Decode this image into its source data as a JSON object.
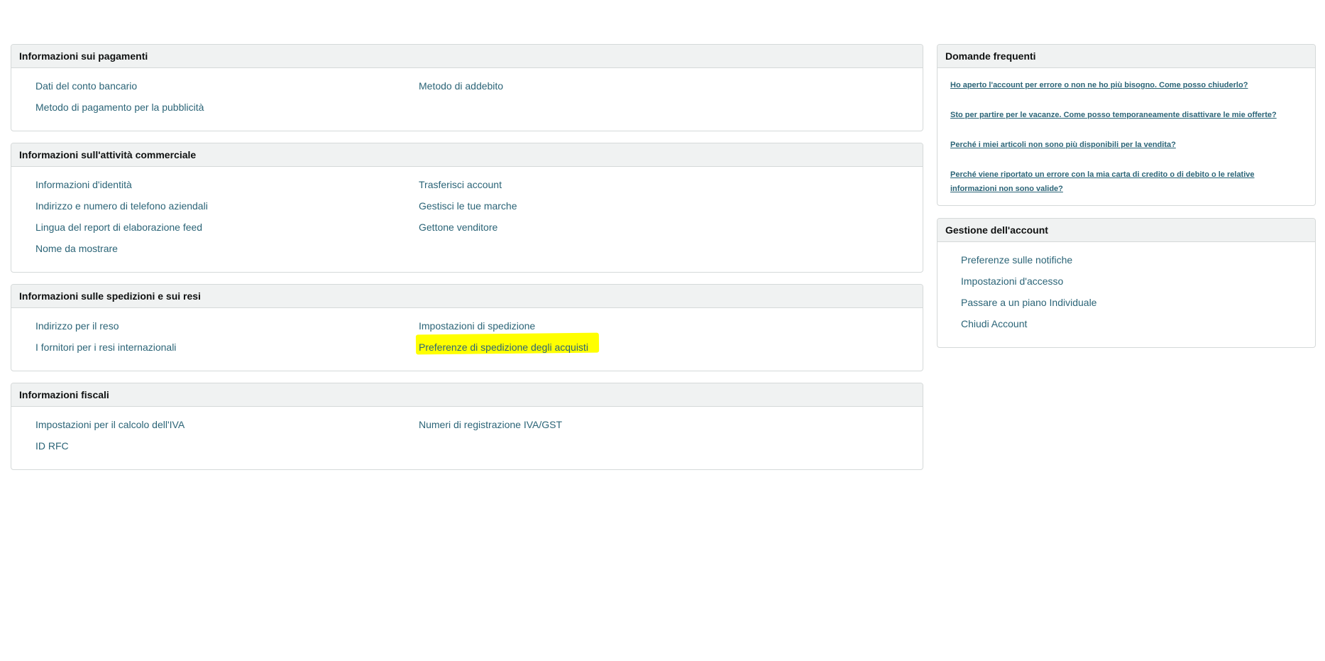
{
  "payments": {
    "title": "Informazioni sui pagamenti",
    "links": [
      "Dati del conto bancario",
      "Metodo di addebito",
      "Metodo di pagamento per la pubblicità"
    ]
  },
  "business": {
    "title": "Informazioni sull'attività commerciale",
    "links": [
      "Informazioni d'identità",
      "Trasferisci account",
      "Indirizzo e numero di telefono aziendali",
      "Gestisci le tue marche",
      "Lingua del report di elaborazione feed",
      "Gettone venditore",
      "Nome da mostrare"
    ]
  },
  "shipping": {
    "title": "Informazioni sulle spedizioni e sui resi",
    "links": [
      "Indirizzo per il reso",
      "Impostazioni di spedizione",
      "I fornitori per i resi internazionali",
      "Preferenze di spedizione degli acquisti"
    ]
  },
  "tax": {
    "title": "Informazioni fiscali",
    "links": [
      "Impostazioni per il calcolo dell'IVA",
      "Numeri di registrazione IVA/GST",
      "ID RFC"
    ]
  },
  "faq": {
    "title": "Domande frequenti",
    "links": [
      "Ho aperto l'account per errore o non ne ho più bisogno. Come posso chiuderlo?",
      "Sto per partire per le vacanze. Come posso temporaneamente disattivare le mie offerte?",
      "Perché i miei articoli non sono più disponibili per la vendita?",
      "Perché viene riportato un errore con la mia carta di credito o di debito o le relative informazioni non sono valide?"
    ]
  },
  "account": {
    "title": "Gestione dell'account",
    "links": [
      "Preferenze sulle notifiche",
      "Impostazioni d'accesso",
      "Passare a un piano Individuale",
      "Chiudi Account"
    ]
  },
  "colors": {
    "link": "#2b6477",
    "header_bg": "#f0f2f2",
    "border": "#d5d9d9",
    "highlight": "#ffff00"
  }
}
